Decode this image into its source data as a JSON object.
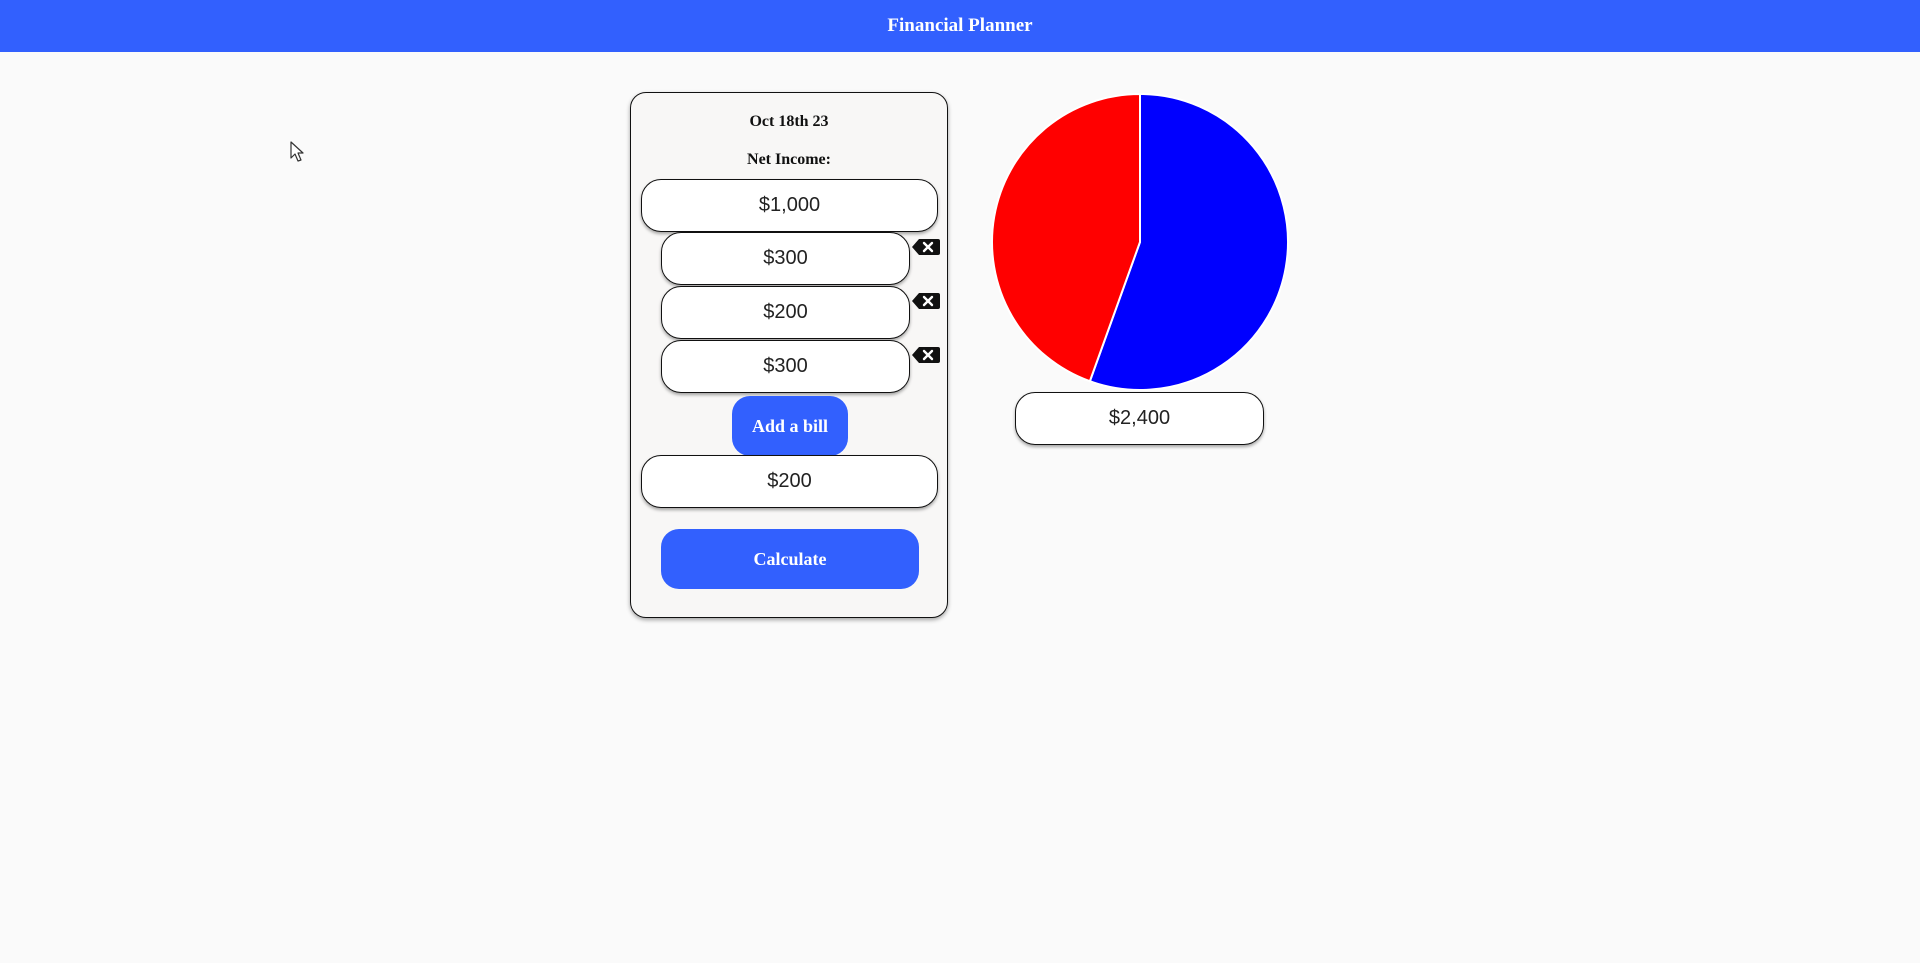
{
  "header": {
    "title": "Financial Planner",
    "color": "#3260fe"
  },
  "planner": {
    "date": "Oct 18th 23",
    "net_income_label": "Net Income:",
    "net_income_value": "$1,000",
    "bills": [
      {
        "amount": "$300",
        "delete_icon": "backspace-x-icon"
      },
      {
        "amount": "$200",
        "delete_icon": "backspace-x-icon"
      },
      {
        "amount": "$300",
        "delete_icon": "backspace-x-icon"
      }
    ],
    "add_bill_label": "Add a bill",
    "remaining_value": "$200",
    "calculate_label": "Calculate"
  },
  "summary": {
    "total_value": "$2,400"
  },
  "chart_data": {
    "type": "pie",
    "slices": [
      {
        "value": 0.555,
        "color": "#0000ff"
      },
      {
        "value": 0.445,
        "color": "#ff0000"
      }
    ]
  }
}
